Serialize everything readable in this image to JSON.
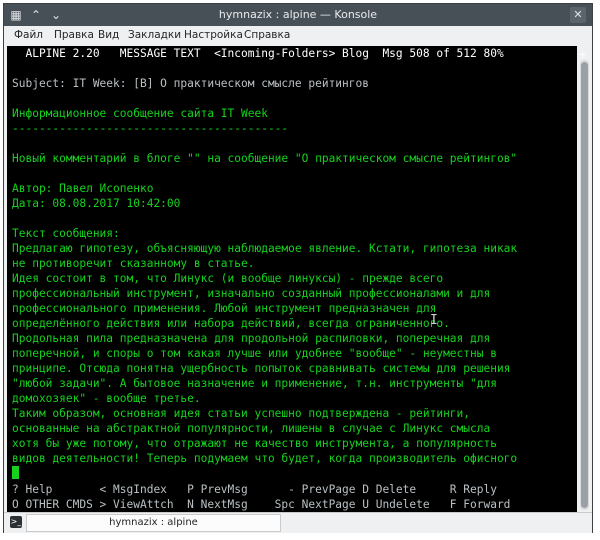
{
  "window": {
    "title": "hymnazix : alpine — Konsole",
    "colors": {
      "titlebar": "#475057",
      "terminal_bg": "#000000",
      "text_green": "#16d21e",
      "text_grey": "#b9c0c4"
    }
  },
  "menu": [
    "Файл",
    "Правка",
    "Вид",
    "Закладки",
    "Настройка",
    "Справка"
  ],
  "alpine": {
    "header": "  ALPINE 2.20   MESSAGE TEXT  <Incoming-Folders> Blog  Msg 508 of 512 80%",
    "subject": "Subject: IT Week: [B] О практическом смысле рейтингов",
    "body": [
      "Информационное сообщение сайта IT Week",
      "-----------------------------------------",
      "",
      "Новый комментарий в блоге \"\" на сообщение \"О практическом смысле рейтингов\"",
      "",
      "Автор: Павел Исопенко",
      "Дата: 08.08.2017 10:42:00",
      "",
      "Текст сообщения:",
      "Предлагаю гипотезу, объясняющую наблюдаемое явление. Кстати, гипотеза никак",
      "не противоречит сказанному в статье.",
      "Идея состоит в том, что Линукс (и вообще линуксы) - прежде всего",
      "профессиональный инструмент, изначально созданный профессионалами и для",
      "профессионального применения. Любой инструмент предназначен для",
      "определённого действия или набора действий, всегда ограниченного.",
      "Продольная пила предназначена для продольной распиловки, поперечная для",
      "поперечной, и споры о том какая лучше или удобнее \"вообще\" - неуместны в",
      "принципе. Отсюда понятна ущербность попыток сравнивать системы для решения",
      "\"любой задачи\". А бытовое назначение и применение, т.н. инструменты \"для",
      "домохозяек\" - вообще третье.",
      "Таким образом, основная идея статьи успешно подтверждена - рейтинги,",
      "основанные на абстрактной популярности, лишены в случае с Линукс смысла",
      "хотя бы уже потому, что отражают не качество инструмента, а популярность",
      "видов деятельности! Теперь подумаем что будет, когда производитель офисного"
    ],
    "help_rows": [
      "? Help       < MsgIndex   P PrevMsg      - PrevPage D Delete     R Reply",
      "O OTHER CMDS > ViewAttch  N NextMsg    Spc NextPage U Undelete   F Forward"
    ]
  },
  "tab": {
    "label": "hymnazix : alpine"
  }
}
